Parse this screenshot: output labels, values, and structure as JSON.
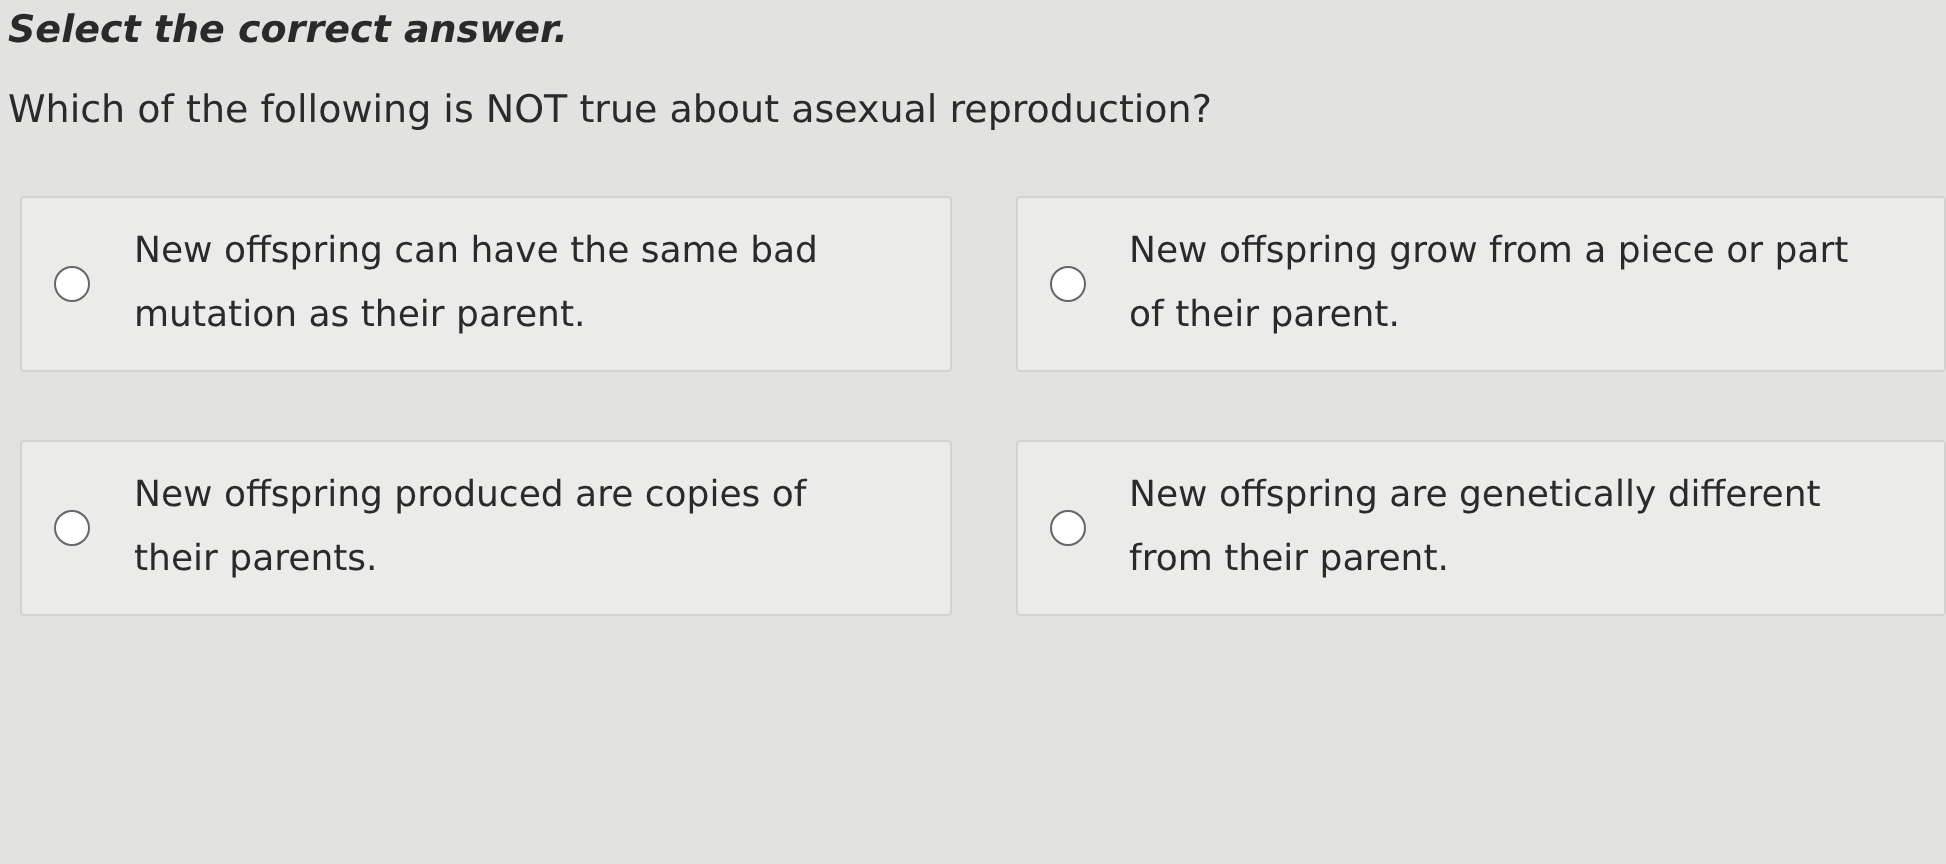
{
  "instruction": "Select the correct answer.",
  "question": "Which of the following is NOT true about asexual reproduction?",
  "options": [
    {
      "text": "New offspring can have the same bad mutation as their parent.",
      "selected": false
    },
    {
      "text": "New offspring grow from a piece or part of their parent.",
      "selected": false
    },
    {
      "text": "New offspring produced are copies of their parents.",
      "selected": false
    },
    {
      "text": "New offspring are genetically different from their parent.",
      "selected": false
    }
  ]
}
